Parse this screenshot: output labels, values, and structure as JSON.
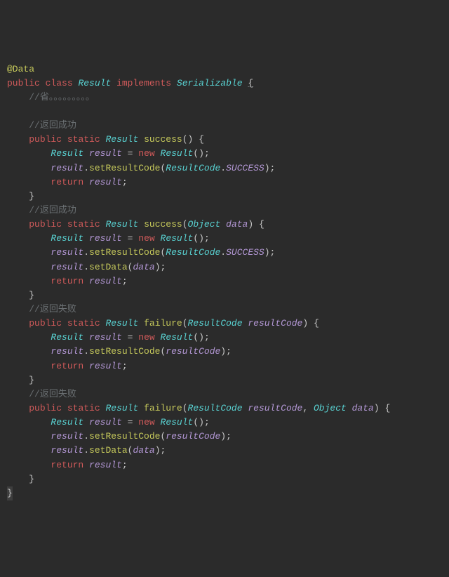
{
  "annot": "@Data",
  "kw": {
    "public": "public",
    "class": "class",
    "implements": "implements",
    "static": "static",
    "return": "return",
    "new": "new"
  },
  "types": {
    "Result": "Result",
    "Serializable": "Serializable",
    "ResultCode": "ResultCode",
    "Object": "Object"
  },
  "methods": {
    "success": "success",
    "failure": "failure",
    "setResultCode": "setResultCode",
    "setData": "setData"
  },
  "consts": {
    "SUCCESS": "SUCCESS"
  },
  "idents": {
    "result": "result",
    "data": "data",
    "resultCode": "resultCode"
  },
  "comments": {
    "omit": "//省",
    "dots": "。。。。。。。。。",
    "retSuccess": "//返回成功",
    "retFailure": "//返回失败"
  },
  "punc": {
    "lbrace": "{",
    "rbrace": "}",
    "lparen": "(",
    "rparen": ")",
    "semi": ";",
    "dot": ".",
    "eq": "=",
    "comma": ","
  }
}
